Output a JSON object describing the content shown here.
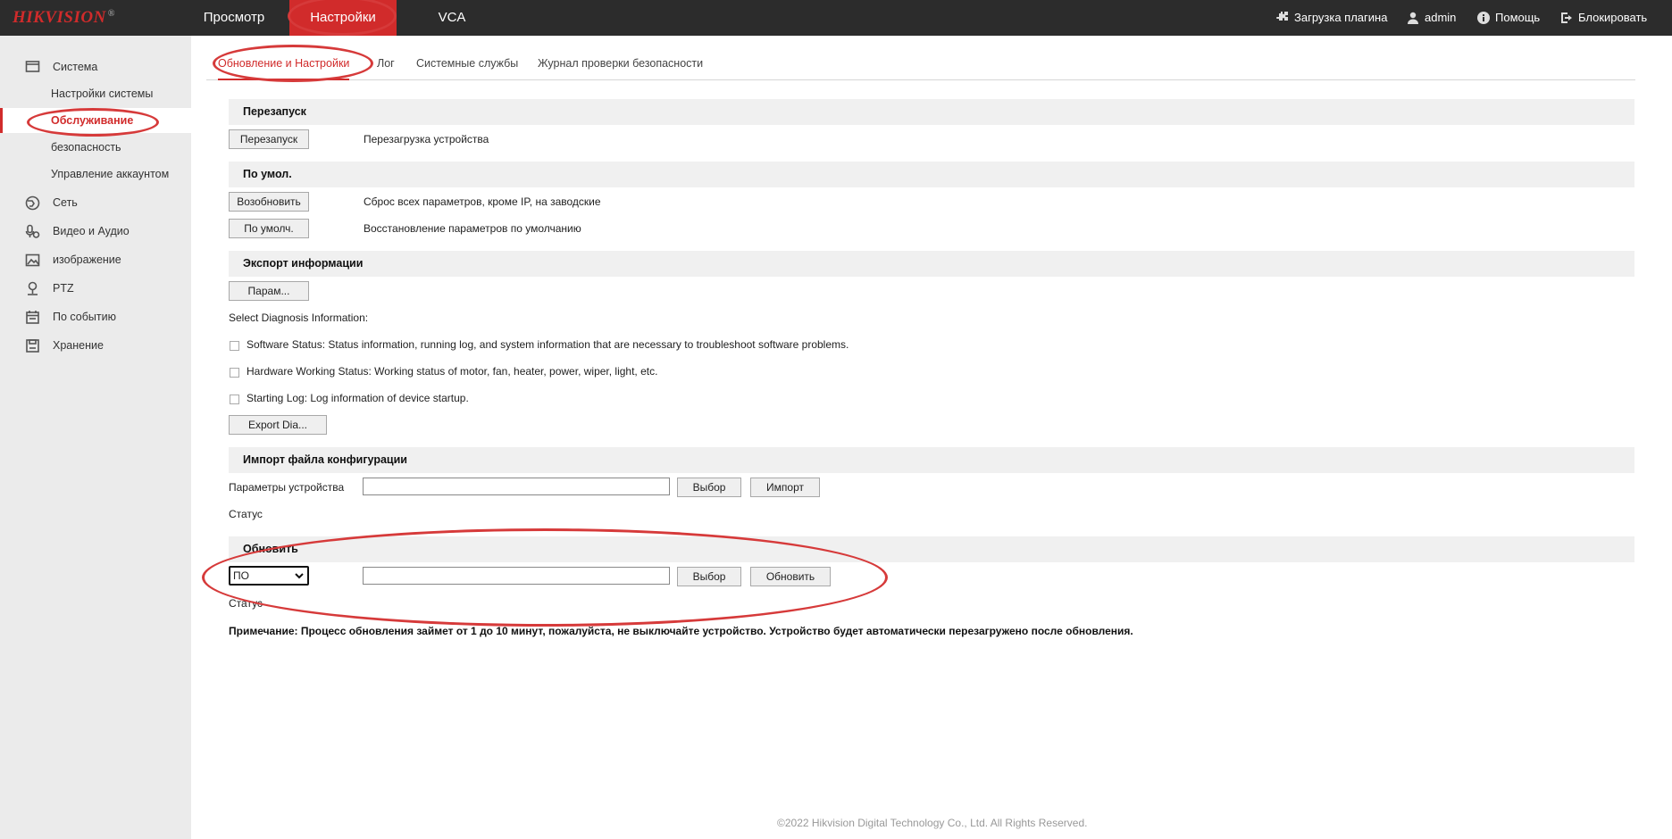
{
  "brand": {
    "logo": "HIKVISION",
    "reg": "®"
  },
  "topnav": {
    "items": [
      "Просмотр",
      "Настройки",
      "VCA"
    ],
    "active_index": 1
  },
  "topright": {
    "plugin": "Загрузка плагина",
    "user": "admin",
    "help": "Помощь",
    "lock": "Блокировать"
  },
  "sidebar": {
    "system": "Система",
    "system_settings": "Настройки системы",
    "maintenance": "Обслуживание",
    "security": "безопасность",
    "account": "Управление аккаунтом",
    "network": "Сеть",
    "video_audio": "Видео и Аудио",
    "image": "изображение",
    "ptz": "PTZ",
    "event": "По событию",
    "storage": "Хранение"
  },
  "tabs": [
    "Обновление и Настройки",
    "Лог",
    "Системные службы",
    "Журнал проверки безопасности"
  ],
  "reboot": {
    "title": "Перезапуск",
    "button": "Перезапуск",
    "desc": "Перезагрузка устройства"
  },
  "defaults": {
    "title": "По умол.",
    "restore_button": "Возобновить",
    "restore_desc": "Сброс всех параметров, кроме IP, на заводские",
    "default_button": "По умолч.",
    "default_desc": "Восстановление параметров по умолчанию"
  },
  "export": {
    "title": "Экспорт информации",
    "params_button": "Парам...",
    "diag_label": "Select Diagnosis Information:",
    "opt1": "Software Status: Status information, running log, and system information that are necessary to troubleshoot software problems.",
    "opt2": "Hardware Working Status: Working status of motor, fan, heater, power, wiper, light, etc.",
    "opt3": "Starting Log: Log information of device startup.",
    "export_button": "Export Dia..."
  },
  "import": {
    "title": "Импорт файла конфигурации",
    "label": "Параметры устройства",
    "value": "",
    "browse": "Выбор",
    "import_button": "Импорт",
    "status": "Статус"
  },
  "upgrade": {
    "title": "Обновить",
    "select_value": "ПО",
    "value": "",
    "browse": "Выбор",
    "upgrade_button": "Обновить",
    "status": "Статус",
    "note": "Примечание: Процесс обновления займет от 1 до 10 минут, пожалуйста, не выключайте устройство. Устройство будет автоматически перезагружено после обновления."
  },
  "footer": "©2022 Hikvision Digital Technology Co., Ltd. All Rights Reserved.",
  "colors": {
    "accent": "#d12b2b",
    "topbar": "#2c2c2c",
    "sidebar": "#ebebeb",
    "annotation": "#d63a3a"
  }
}
